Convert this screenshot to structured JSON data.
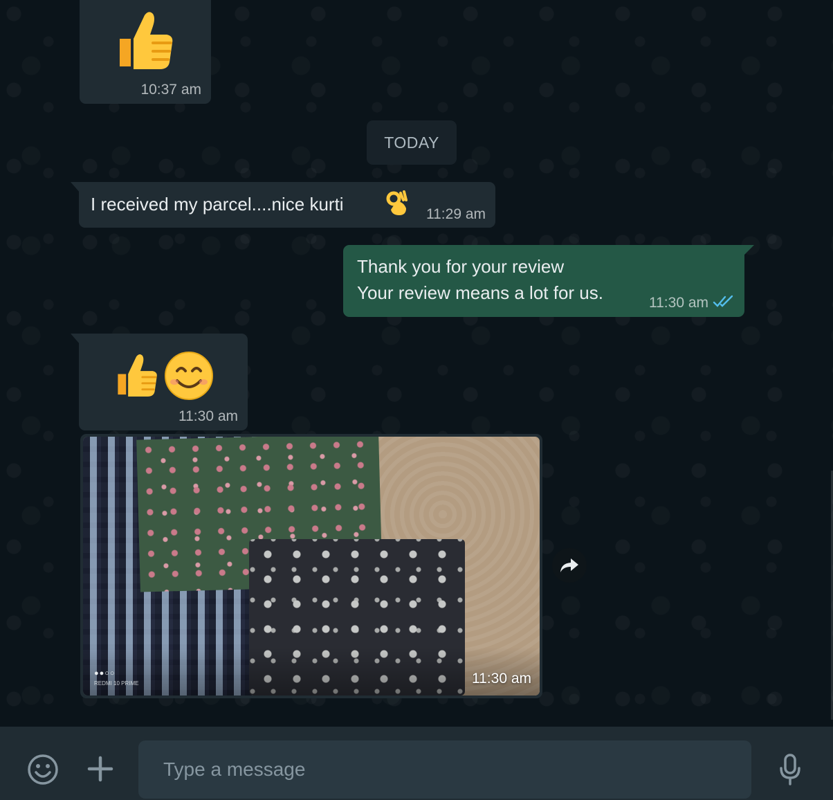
{
  "messages": [
    {
      "id": "m1",
      "direction": "incoming",
      "content": "emoji",
      "emoji": [
        "thumbs-up"
      ],
      "time": "10:37 am"
    },
    {
      "id": "m2",
      "direction": "incoming",
      "content": "text",
      "text": "I received my parcel....nice kurti",
      "trailing_emoji": "ok-hand",
      "time": "11:29 am"
    },
    {
      "id": "m3",
      "direction": "outgoing",
      "content": "text",
      "lines": [
        "Thank you for your review",
        "Your review means a lot for us."
      ],
      "time": "11:30 am",
      "status": "read",
      "status_icon": "double-check-icon"
    },
    {
      "id": "m4",
      "direction": "incoming",
      "content": "emoji",
      "emoji": [
        "thumbs-up",
        "smiling-face"
      ],
      "time": "11:30 am"
    },
    {
      "id": "m5",
      "direction": "incoming",
      "content": "image",
      "image_subject": "fabric pieces in plastic wrap",
      "watermark_dots": "●●○○",
      "watermark": "REDMI 10 PRIME",
      "time": "11:30 am"
    }
  ],
  "date_separator": "TODAY",
  "composer": {
    "placeholder": "Type a message",
    "emoji_icon": "emoji-icon",
    "attach_icon": "plus-icon",
    "mic_icon": "microphone-icon"
  },
  "colors": {
    "chat_background": "#0b141a",
    "incoming_bubble": "#202c33",
    "outgoing_bubble": "#245846",
    "read_tick": "#53bdeb",
    "composer_bg": "#202c33",
    "input_bg": "#2a3942"
  }
}
